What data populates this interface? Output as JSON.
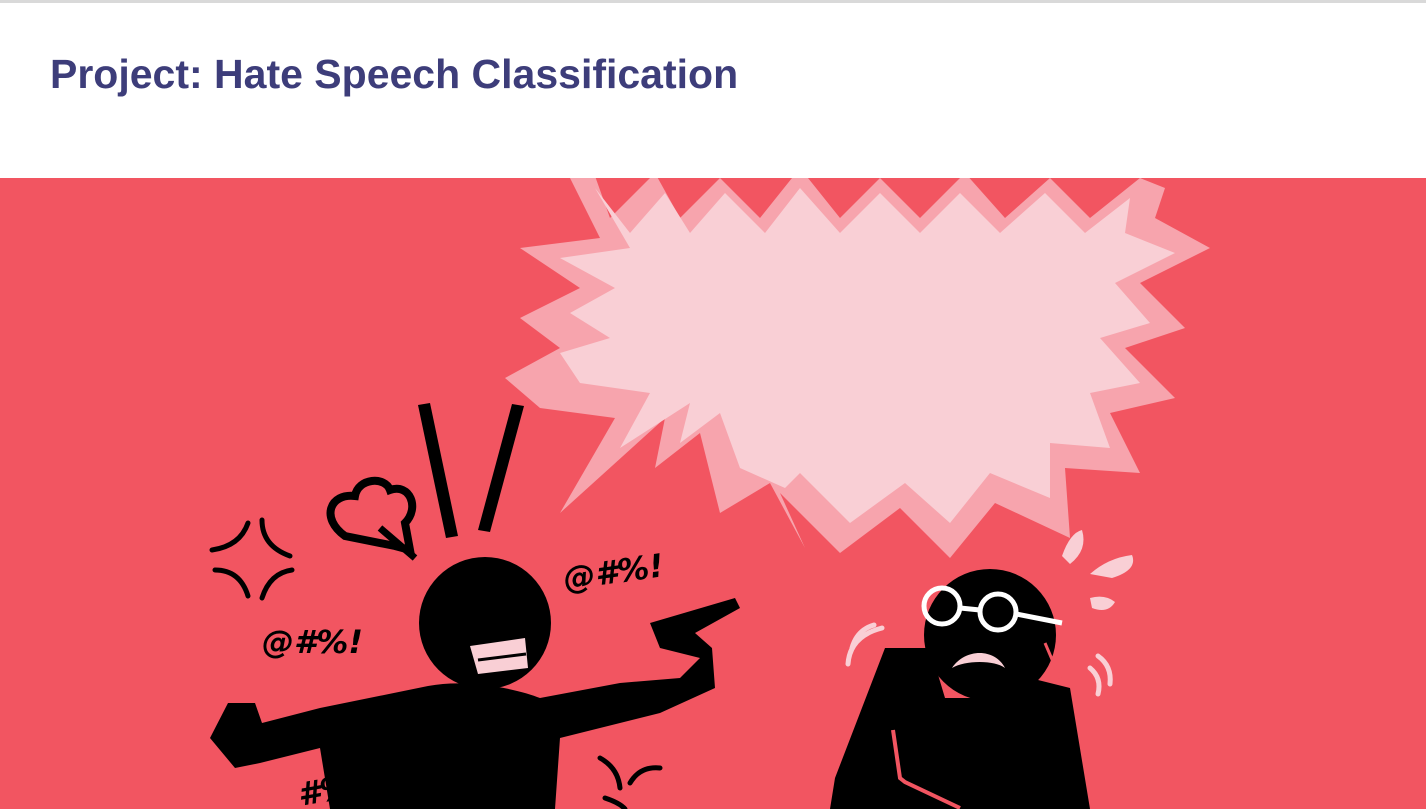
{
  "page": {
    "title": "Project: Hate Speech Classification"
  },
  "hero": {
    "background_color": "#f25561",
    "bubble_color": "#f9cfd5",
    "bubble_outline_color": "#f7a4ad",
    "figure_color": "#000000",
    "symbols": [
      "@#%!",
      "@#%!",
      "#%!"
    ],
    "icons": [
      "speech-bubble-icon",
      "angry-vein-icon",
      "steam-puff-icon",
      "pointing-figure-icon",
      "scared-figure-icon",
      "sweat-drops-icon",
      "trembling-marks-icon"
    ]
  },
  "colors": {
    "title": "#3d3d7a",
    "top_rule": "#d9d9d9"
  }
}
